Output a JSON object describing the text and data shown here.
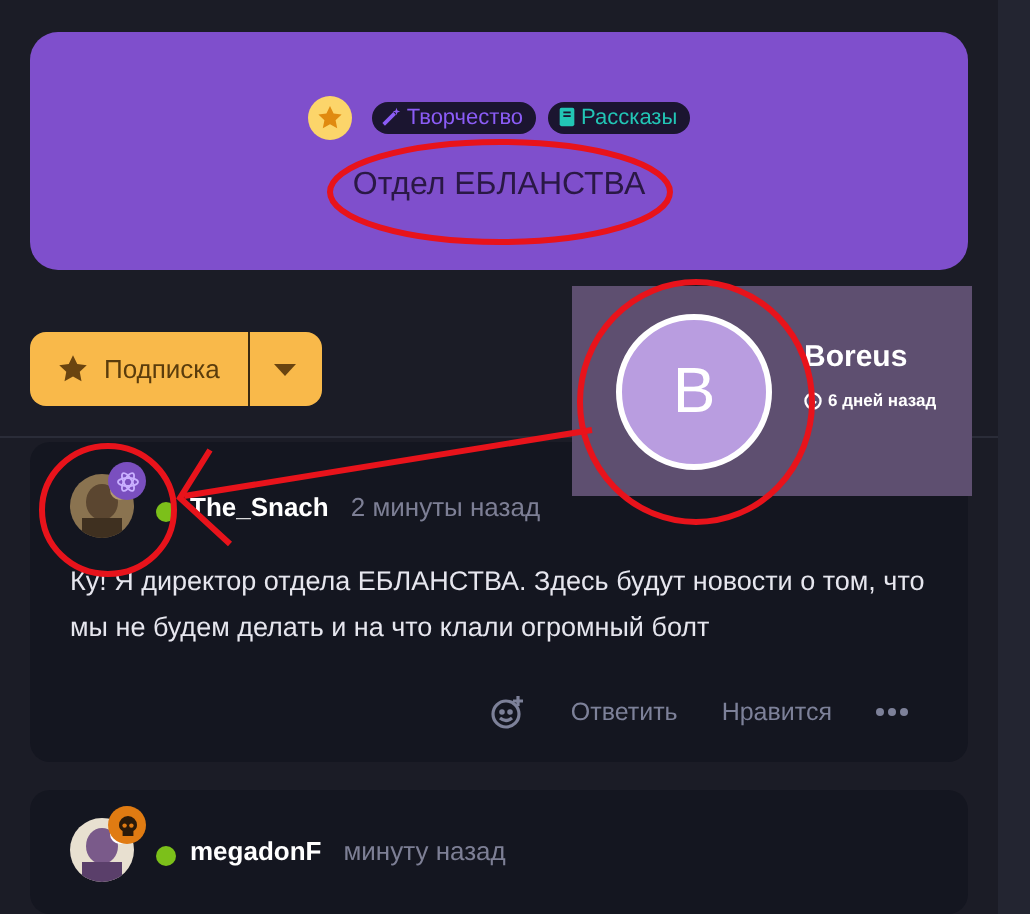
{
  "header": {
    "tags": [
      {
        "kind": "creativity",
        "label": "Творчество",
        "color": "#8b5cf6"
      },
      {
        "kind": "stories",
        "label": "Рассказы",
        "color": "#22c5b5"
      }
    ],
    "title": "Отдел ЕБЛАНСТВА"
  },
  "subscribe": {
    "label": "Подписка"
  },
  "hover_card": {
    "initial": "B",
    "name": "Boreus",
    "time": "6 дней назад"
  },
  "posts": [
    {
      "author": "The_Snach",
      "time": "2 минуты назад",
      "online": true,
      "badge": {
        "kind": "atom"
      },
      "text": "Ку! Я директор отдела ЕБЛАНСТВА. Здесь будут новости о том, что мы не будем делать и на что клали огромный болт",
      "actions": [
        "Ответить",
        "Нравится"
      ]
    },
    {
      "author": "megadonF",
      "time": "минуту назад",
      "online": true,
      "badge": {
        "kind": "skull"
      }
    }
  ]
}
